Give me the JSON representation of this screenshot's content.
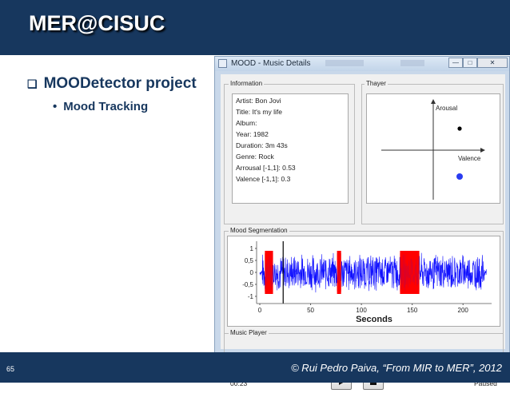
{
  "slide": {
    "title": "MER@CISUC",
    "bullet1": "MOODetector project",
    "bullet1_mark": "❑",
    "bullet2": "Mood Tracking",
    "bullet2_mark": "•",
    "page_number": "65",
    "footer": "© Rui Pedro Paiva, “From MIR to MER”, 2012",
    "colors": {
      "bar": "#17375e",
      "text": "#17375e",
      "window": "#c9d8ea"
    }
  },
  "window": {
    "title": "MOOD - Music Details",
    "controls": {
      "minimize": "—",
      "maximize": "□",
      "close": "✕"
    }
  },
  "information": {
    "label": "Information",
    "lines": [
      "Artist: Bon Jovi",
      "Title: It's my life",
      "Album:",
      "Year: 1982",
      "Duration: 3m 43s",
      "Genre: Rock",
      "Arrousal [-1,1]: 0.53",
      "Valence [-1,1]: 0.3"
    ]
  },
  "thayer": {
    "label": "Thayer",
    "arousal_label": "Arousal",
    "valence_label": "Valence",
    "points": [
      {
        "valence": 0.55,
        "arousal": 0.45,
        "color": "#000000"
      },
      {
        "valence": 0.55,
        "arousal": -0.55,
        "color": "#2a3cf0"
      }
    ]
  },
  "segmentation": {
    "label": "Mood Segmentation",
    "xlabel": "Seconds",
    "xticks": [
      "0",
      "50",
      "100",
      "150",
      "200"
    ],
    "yticks": [
      "1",
      "0,5",
      "0",
      "-0,5",
      "-1"
    ],
    "wave_color": "#1010ff",
    "highlight_color": "#ff0000",
    "highlight_ranges": [
      [
        5,
        13
      ],
      [
        76,
        80
      ],
      [
        138,
        157
      ]
    ],
    "cursor_seconds": 23
  },
  "chart_data": {
    "type": "line",
    "title": "",
    "xlabel": "Seconds",
    "ylabel": "",
    "xlim": [
      0,
      225
    ],
    "ylim": [
      -1.3,
      1.3
    ],
    "note": "audio waveform amplitude with red highlighted mood segments",
    "highlight_ranges": [
      [
        5,
        13
      ],
      [
        76,
        80
      ],
      [
        138,
        157
      ]
    ]
  },
  "player": {
    "label": "Music Player",
    "time": "00:23",
    "status": "Paused",
    "play_icon": "play-icon",
    "stop_icon": "stop-icon"
  }
}
